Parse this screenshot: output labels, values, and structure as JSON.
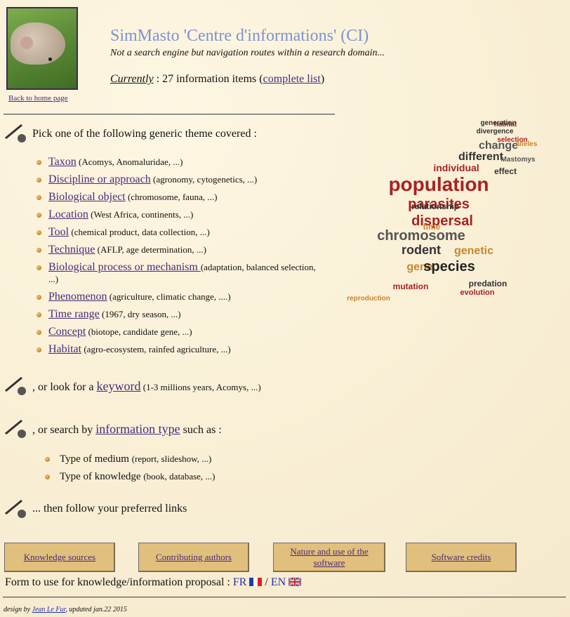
{
  "header": {
    "title": "SimMasto 'Centre d'informations' (CI)",
    "subtitle": "Not a search engine but navigation routes within a research domain...",
    "currently_label": "Currently",
    "currently_text": " : 27 information items (",
    "complete_list": "complete list",
    "close_paren": ")",
    "back_link": "Back to home page"
  },
  "themes": {
    "lead": "Pick one of the following generic theme covered :",
    "items": [
      {
        "label": "Taxon",
        "hint": " (Acomys, Anomaluridae, ...)"
      },
      {
        "label": "Discipline or approach",
        "hint": " (agronomy, cytogenetics, ...)"
      },
      {
        "label": "Biological object",
        "hint": " (chromosome, fauna, ...)"
      },
      {
        "label": "Location",
        "hint": "  (West Africa, continents, ...)"
      },
      {
        "label": "Tool",
        "hint": "  (chemical product, data collection, ...)"
      },
      {
        "label": "Technique",
        "hint": "  (AFLP, age determination, ...)"
      },
      {
        "label": "Biological process or mechanism ",
        "hint": "(adaptation, balanced selection, ...)"
      },
      {
        "label": "Phenomenon",
        "hint": " (agriculture, climatic change, ....)"
      },
      {
        "label": "Time range",
        "hint": "  (1967, dry season, ...)"
      },
      {
        "label": "Concept",
        "hint": "  (biotope, candidate gene, ...)"
      },
      {
        "label": "Habitat",
        "hint": " (agro-ecosystem, rainfed agriculture, ...)"
      }
    ]
  },
  "keyword": {
    "prefix": ", or look for a ",
    "link": "keyword",
    "hint": " (1-3 millions years, Acomys, ...)"
  },
  "info_type": {
    "prefix": ", or search by ",
    "link": "information type",
    "suffix": " such as :",
    "items": [
      {
        "label": "Type of medium ",
        "hint": "(report, slideshow, ...)"
      },
      {
        "label": "Type of knowledge ",
        "hint": "(book, database, ...)"
      }
    ]
  },
  "follow": "... then follow your preferred links",
  "nav_buttons": [
    "Knowledge sources",
    "Contributing authors",
    "Nature and use of the software",
    "Software credits"
  ],
  "form": {
    "text": "Form to use for knowledge/information proposal : ",
    "fr": "FR",
    "sep": "  / ",
    "en": "EN"
  },
  "footer": {
    "prefix": "design by ",
    "author": "Jean Le Fur",
    "suffix": ", updated  jan.22 2015"
  },
  "word_cloud": [
    "population",
    "parasites",
    "dispersal",
    "chromosome",
    "rodent",
    "genetic",
    "gene",
    "species",
    "individual",
    "different",
    "change",
    "effect",
    "selection",
    "divergence",
    "mutation",
    "reproduction",
    "evolution",
    "relationship",
    "time",
    "alleles",
    "Mastomys",
    "predation",
    "habitat",
    "generation"
  ],
  "colors": {
    "title": "#7b93d0",
    "link": "#4a2a7a",
    "button": "#e1bf7d",
    "background": "#fbf1d8"
  }
}
